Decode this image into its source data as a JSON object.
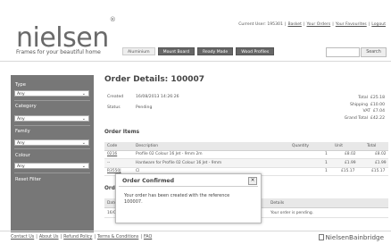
{
  "header": {
    "logo": "nielsen",
    "logo_mark": "®",
    "tagline": "Frames for your beautiful home",
    "current_user_label": "Current User:",
    "current_user_value": "195301",
    "links": [
      "Basket",
      "Your Orders",
      "Your Favourites",
      "Logout"
    ],
    "nav_tabs": [
      {
        "label": "Aluminium",
        "dark": false
      },
      {
        "label": "Mount Board",
        "dark": true
      },
      {
        "label": "Ready Made",
        "dark": true
      },
      {
        "label": "Wood Profiles",
        "dark": true
      }
    ],
    "search_button": "Search"
  },
  "sidebar": {
    "type_label": "Type",
    "type_value": "Any",
    "category_label": "Category",
    "category_value": "Any",
    "family_label": "Family",
    "family_value": "Any",
    "colour_label": "Colour",
    "colour_value": "Any",
    "reset_label": "Reset Filter"
  },
  "order": {
    "title": "Order Details: 100007",
    "created_label": "Created",
    "created_value": "16/08/2013 14:26:26",
    "status_label": "Status",
    "status_value": "Pending",
    "totals": [
      {
        "label": "Total",
        "value": "£25.18"
      },
      {
        "label": "Shipping",
        "value": "£10.00"
      },
      {
        "label": "VAT",
        "value": "£7.04"
      },
      {
        "label": "Grand Total",
        "value": "£42.22"
      }
    ]
  },
  "items": {
    "heading": "Order Items",
    "columns": [
      "Code",
      "Description",
      "Quantity",
      "Unit",
      "Total"
    ],
    "rows": [
      {
        "code": "0216",
        "description": "Profile 02 Colour 16 Jet - 9mm 2m",
        "quantity": "1",
        "unit": "£8.02",
        "total": "£8.02"
      },
      {
        "code": "--",
        "description": "Hardware for Profile 02 Colour 16 Jet - 9mm",
        "quantity": "1",
        "unit": "£1.99",
        "total": "£1.99"
      },
      {
        "code": "R3550J",
        "description": "Cl",
        "quantity": "1",
        "unit": "£15.17",
        "total": "£15.17"
      }
    ]
  },
  "tracking": {
    "heading": "Order Tracki",
    "columns": [
      "Date",
      "Details"
    ],
    "rows": [
      {
        "date": "16/08/2013 14",
        "details": "Your order is pending."
      }
    ]
  },
  "modal": {
    "title": "Order Confirmed",
    "close": "✕",
    "body": "Your order has been created with the reference 100007."
  },
  "footer": {
    "links": [
      "Contact Us",
      "About Us",
      "Refund Policy",
      "Terms & Conditions",
      "FAQ"
    ],
    "brand": "NielsenBainbridge"
  }
}
